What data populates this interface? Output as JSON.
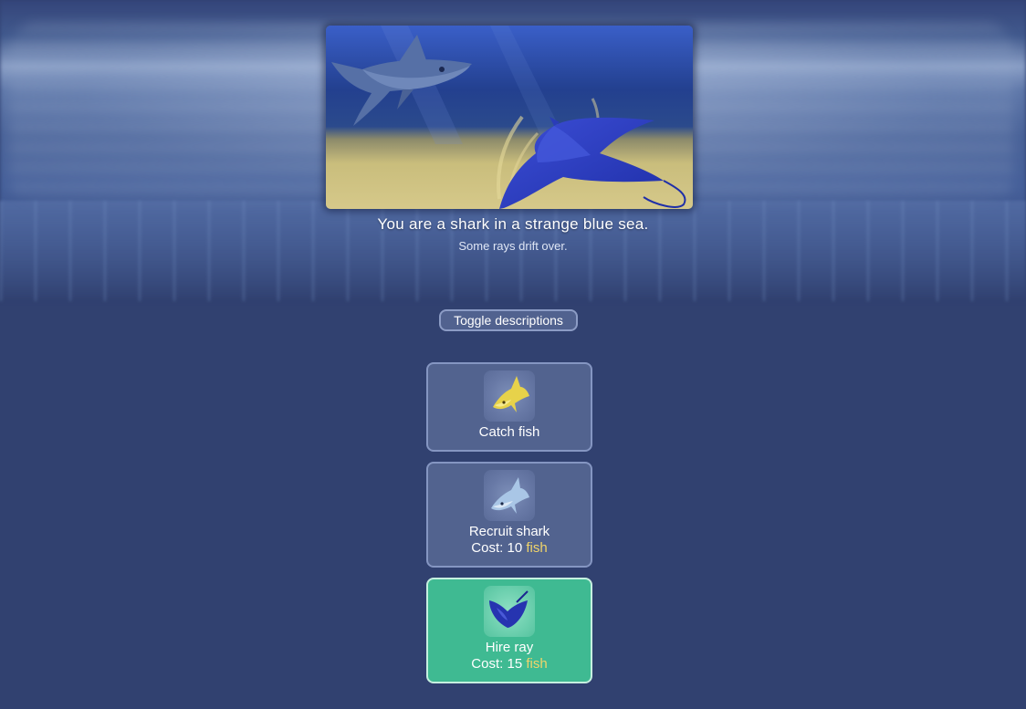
{
  "scene": {
    "title": "You are a shark in a strange blue sea.",
    "subtitle": "Some rays drift over."
  },
  "toggle": {
    "label": "Toggle descriptions"
  },
  "actions": [
    {
      "label": "Catch fish",
      "icon": "yellow-shark-icon",
      "cost_prefix": "",
      "cost_resource": ""
    },
    {
      "label": "Recruit shark",
      "icon": "shark-icon",
      "cost_prefix": "Cost: 10",
      "cost_resource": "fish"
    },
    {
      "label": "Hire ray",
      "icon": "ray-icon",
      "cost_prefix": "Cost: 15",
      "cost_resource": "fish",
      "highlighted": true
    }
  ],
  "colors": {
    "background": "#314170",
    "button": "#52638f",
    "highlight": "#3fba92",
    "resource_text": "#f0d46a"
  }
}
